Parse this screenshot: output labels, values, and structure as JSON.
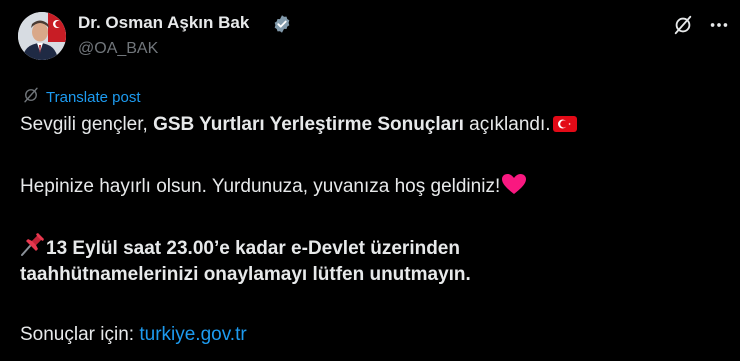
{
  "author": {
    "name": "Dr. Osman Aşkın Bak",
    "handle": "@OA_BAK"
  },
  "icons": {
    "verified": "verified-badge-icon",
    "grok": "grok-icon",
    "more": "more-options-icon",
    "translate": "translate-icon",
    "turkey_flag": "turkey-flag-emoji",
    "heart": "red-heart-emoji",
    "pushpin": "pushpin-emoji"
  },
  "colors": {
    "background": "#000000",
    "text": "#e7e9ea",
    "muted": "#71767b",
    "link": "#1d9bf0",
    "verified": "#829aab",
    "flag_red": "#e30a17",
    "heart_red": "#f91880"
  },
  "translate": {
    "label": "Translate post"
  },
  "post": {
    "line1_prefix": "Sevgili gençler, ",
    "line1_bold": "GSB Yurtları Yerleştirme Sonuçları",
    "line1_suffix": " açıklandı.",
    "line2": "Hepinize hayırlı olsun. Yurdunuza, yuvanıza hoş geldiniz!",
    "line3": "13 Eylül saat 23.00’e kadar e-Devlet üzerinden",
    "line4": "taahhütnamelerinizi onaylamayı lütfen unutmayın.",
    "line5_prefix": "Sonuçlar için: ",
    "line5_link": "turkiye.gov.tr"
  }
}
